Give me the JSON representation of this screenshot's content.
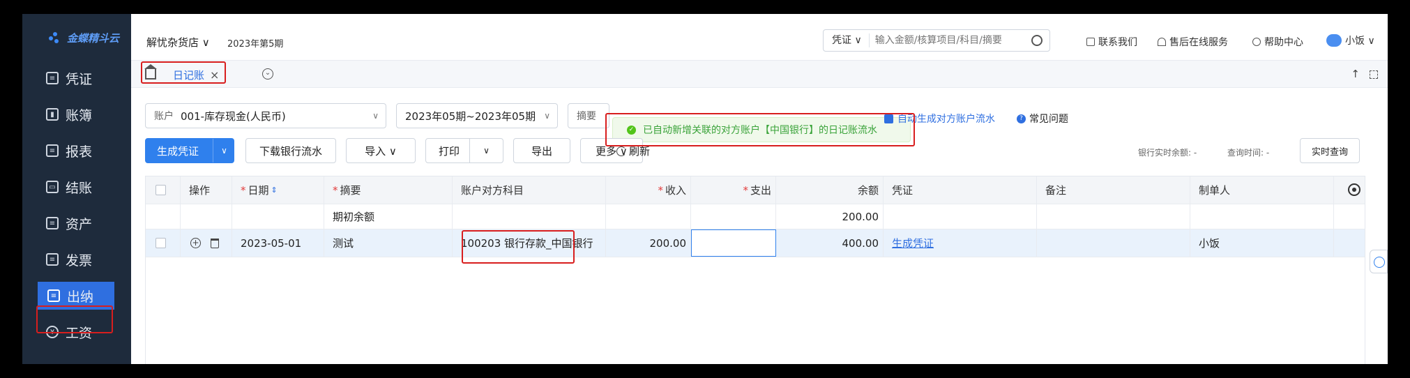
{
  "app": {
    "logo_text": "金蝶精斗云"
  },
  "sidebar": {
    "items": [
      {
        "label": "凭证",
        "icon": "voucher-icon",
        "active": false
      },
      {
        "label": "账簿",
        "icon": "ledger-icon",
        "active": false
      },
      {
        "label": "报表",
        "icon": "report-icon",
        "active": false
      },
      {
        "label": "结账",
        "icon": "closing-icon",
        "active": false
      },
      {
        "label": "资产",
        "icon": "asset-icon",
        "active": false
      },
      {
        "label": "发票",
        "icon": "invoice-icon",
        "active": false
      },
      {
        "label": "出纳",
        "icon": "cashier-icon",
        "active": true
      },
      {
        "label": "工资",
        "icon": "salary-icon",
        "active": false
      }
    ]
  },
  "topbar": {
    "store": "解忧杂货店 ∨",
    "period": "2023年第5期",
    "search_type": "凭证 ∨",
    "search_placeholder": "输入金额/核算项目/科目/摘要",
    "contact": "联系我们",
    "online_service": "售后在线服务",
    "help": "帮助中心",
    "user": "小饭 ∨"
  },
  "tabs": {
    "journal": "日记账",
    "close": "×"
  },
  "filters": {
    "account_label": "账户",
    "account_value": "001-库存现金(人民币)",
    "period_range": "2023年05期~2023年05期",
    "summary_label": "摘要",
    "auto_generate": "自动生成对方账户流水",
    "faq": "常见问题"
  },
  "toast": {
    "message": "已自动新增关联的对方账户【中国银行】的日记账流水"
  },
  "toolbar": {
    "generate": "生成凭证",
    "download_bank": "下载银行流水",
    "import": "导入 ∨",
    "print": "打印",
    "export": "导出",
    "more": "更多 ∨",
    "refresh": "刷新",
    "bank_balance": "银行实时余额: -",
    "query_time": "查询时间: -",
    "realtime_query": "实时查询"
  },
  "table": {
    "headers": {
      "action": "操作",
      "date": "日期",
      "summary": "摘要",
      "counter_subject": "账户对方科目",
      "income": "收入",
      "expense": "支出",
      "balance": "余额",
      "voucher": "凭证",
      "remark": "备注",
      "maker": "制单人"
    },
    "opening": {
      "summary": "期初余额",
      "balance": "200.00"
    },
    "rows": [
      {
        "date": "2023-05-01",
        "summary": "测试",
        "counter_subject": "100203 银行存款_中国银行",
        "income": "200.00",
        "expense": "",
        "balance": "400.00",
        "voucher": "生成凭证",
        "remark": "",
        "maker": "小饭"
      }
    ]
  },
  "colors": {
    "accent": "#2f80ed",
    "sidebar_bg": "#1e2b3c",
    "annotation": "#d81e1e"
  }
}
